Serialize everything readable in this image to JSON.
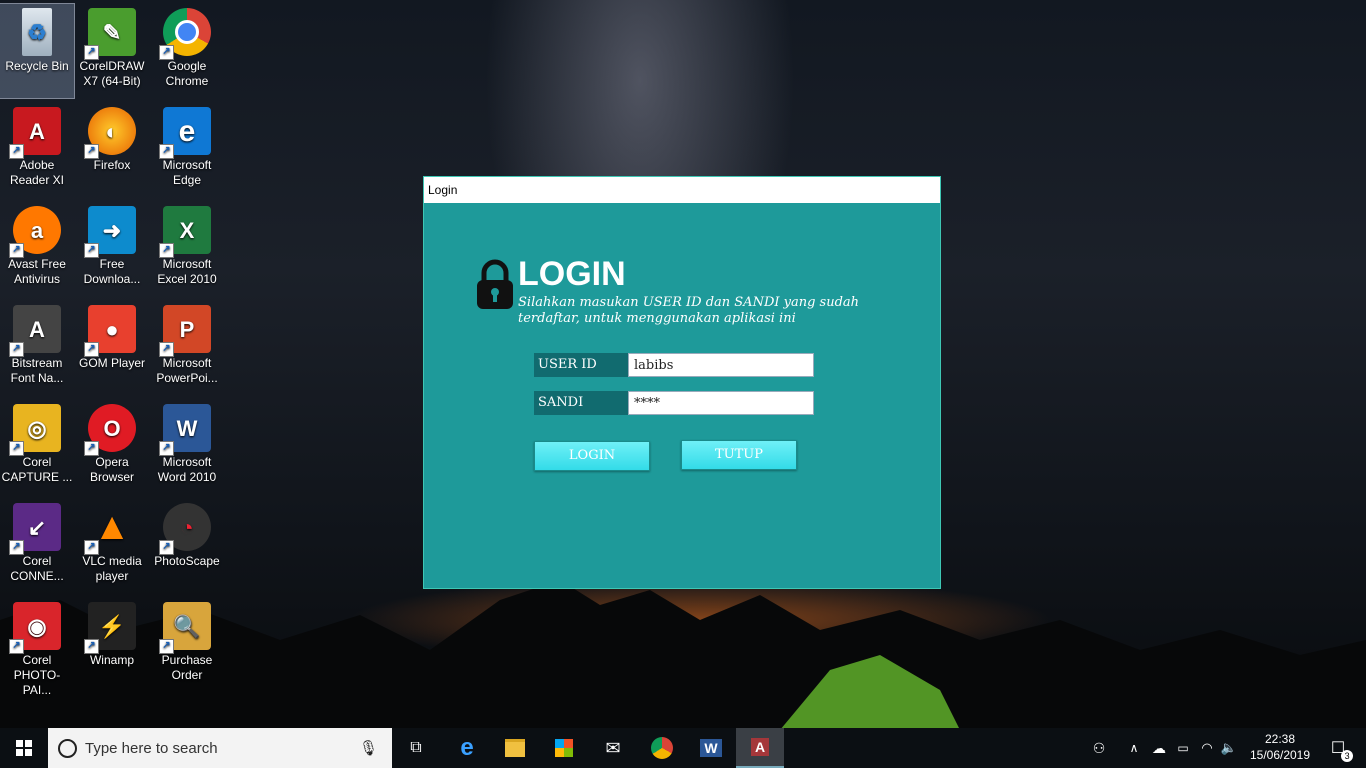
{
  "desktop": {
    "icons": [
      {
        "label": "Recycle Bin"
      },
      {
        "label": "CorelDRAW X7 (64-Bit)"
      },
      {
        "label": "Google Chrome"
      },
      {
        "label": "Adobe Reader XI"
      },
      {
        "label": "Firefox"
      },
      {
        "label": "Microsoft Edge"
      },
      {
        "label": "Avast Free Antivirus"
      },
      {
        "label": "Free Downloa..."
      },
      {
        "label": "Microsoft Excel 2010"
      },
      {
        "label": "Bitstream Font Na..."
      },
      {
        "label": "GOM Player"
      },
      {
        "label": "Microsoft PowerPoi..."
      },
      {
        "label": "Corel CAPTURE ..."
      },
      {
        "label": "Opera Browser"
      },
      {
        "label": "Microsoft Word 2010"
      },
      {
        "label": "Corel CONNE..."
      },
      {
        "label": "VLC media player"
      },
      {
        "label": "PhotoScape"
      },
      {
        "label": "Corel PHOTO-PAI..."
      },
      {
        "label": "Winamp"
      },
      {
        "label": "Purchase Order"
      }
    ]
  },
  "login_window": {
    "title": "Login",
    "heading": "LOGIN",
    "subtitle": "Silahkan masukan USER ID dan SANDI yang sudah terdaftar, untuk menggunakan aplikasi ini",
    "user_id_label": "USER ID",
    "user_id_value": "labibs",
    "sandi_label": "SANDI",
    "sandi_value": "****",
    "login_button": "LOGIN",
    "close_button": "TUTUP",
    "colors": {
      "background": "#1e9a9a",
      "label_bg": "#116b6f",
      "button": "#33dbe8"
    }
  },
  "taskbar": {
    "search_placeholder": "Type here to search",
    "time": "22:38",
    "date": "15/06/2019",
    "notification_count": "3",
    "apps": [
      "task-view",
      "edge",
      "file-explorer",
      "store",
      "mail",
      "chrome",
      "word",
      "access"
    ]
  }
}
